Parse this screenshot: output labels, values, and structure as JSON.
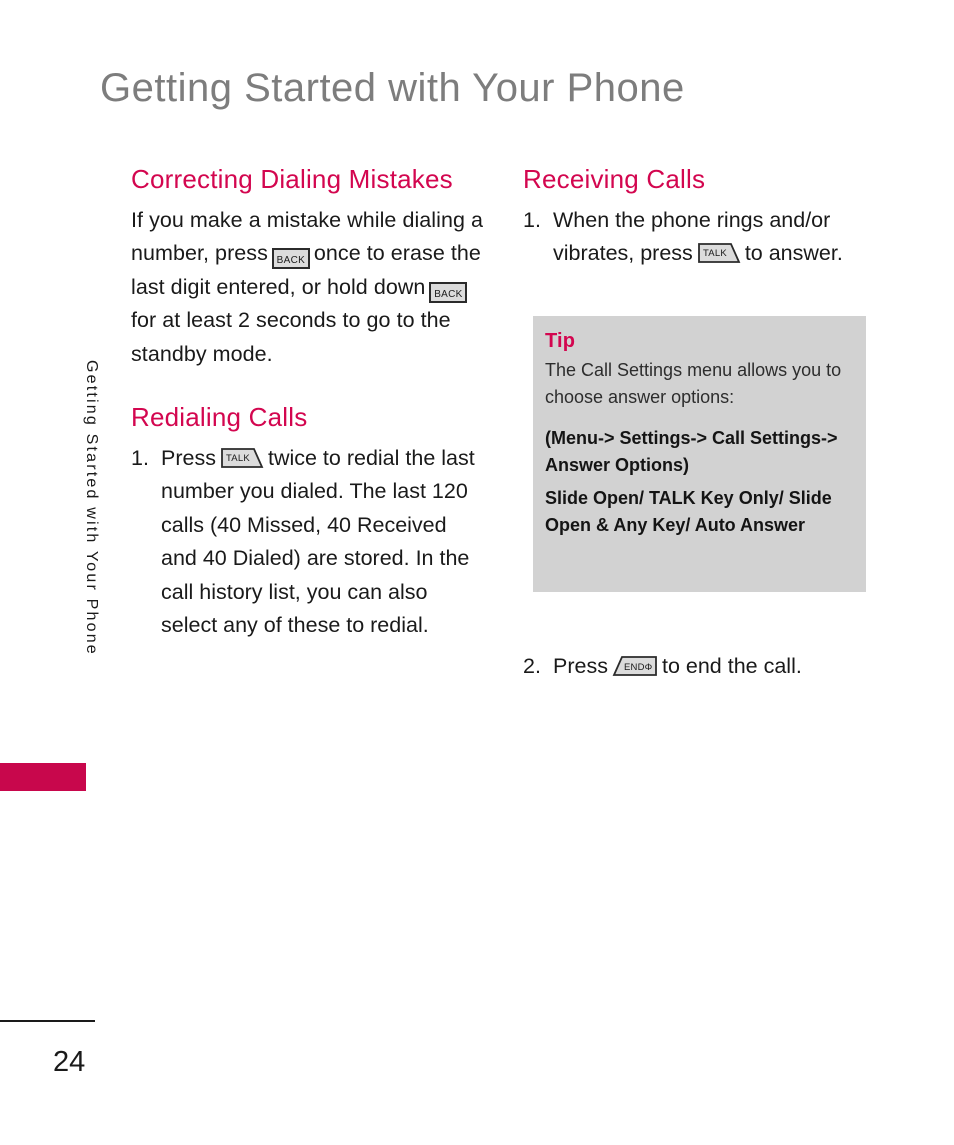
{
  "page": {
    "title": "Getting Started with Your Phone",
    "side_tab_label": "Getting Started with Your Phone",
    "page_number": "24"
  },
  "keys": {
    "back": "BACK",
    "talk": "TALK",
    "end": "END",
    "end_symbol": "Φ"
  },
  "left_column": {
    "heading1": "Correcting Dialing Mistakes",
    "para1_part1": "If you make a mistake while dialing a number, press",
    "para1_part2": "once to erase the last digit entered, or hold down",
    "para1_part3": "for at least 2 seconds to go to the standby mode.",
    "heading2": "Redialing Calls",
    "item1_number": "1.",
    "item1_part1": "Press",
    "item1_part2": "twice to redial the last number you dialed. The last 120 calls (40 Missed, 40 Received and 40 Dialed) are stored. In the call history list, you can also select any of these to redial."
  },
  "right_column": {
    "heading1": "Receiving Calls",
    "item1_number": "1.",
    "item1_part1": "When the phone rings and/or vibrates, press",
    "item1_part2": "to answer.",
    "item2_number": "2.",
    "item2_part1": "Press",
    "item2_part2": "to end the call."
  },
  "tip": {
    "title": "Tip",
    "line1": "The Call Settings menu allows you to choose answer options:",
    "line2": "(Menu-> Settings-> Call Settings-> Answer Options)",
    "line3": "Slide Open/ TALK Key Only/ Slide Open & Any Key/ Auto Answer"
  },
  "colors": {
    "accent": "#d3064f",
    "title_gray": "#7d7d7d",
    "tip_bg": "#d2d2d2",
    "tab_block": "#c8074c"
  }
}
